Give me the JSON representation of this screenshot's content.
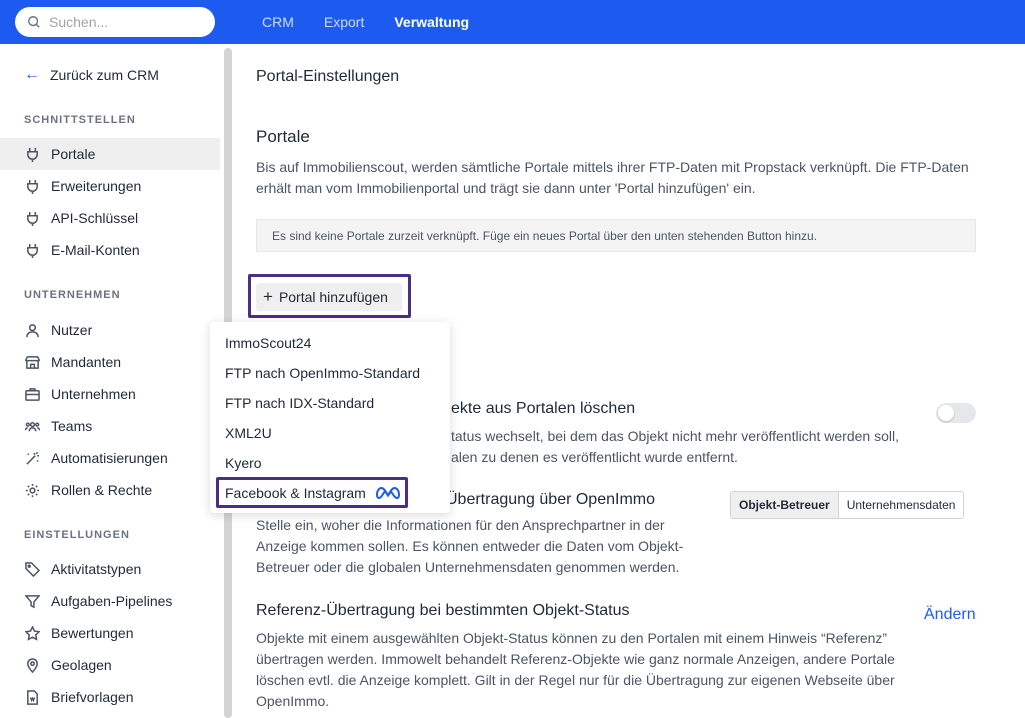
{
  "search": {
    "placeholder": "Suchen..."
  },
  "topnav": [
    "CRM",
    "Export",
    "Verwaltung"
  ],
  "sidebar": {
    "back_label": "Zurück zum CRM",
    "sections": {
      "schnittstellen": "SCHNITTSTELLEN",
      "unternehmen": "UNTERNEHMEN",
      "einstellungen": "EINSTELLUNGEN"
    },
    "items": {
      "portale": "Portale",
      "erweiterungen": "Erweiterungen",
      "api": "API-Schlüssel",
      "email": "E-Mail-Konten",
      "nutzer": "Nutzer",
      "mandanten": "Mandanten",
      "unternehmen": "Unternehmen",
      "teams": "Teams",
      "automatisierungen": "Automatisierungen",
      "rollen": "Rollen & Rechte",
      "aktivitaetstypen": "Aktivitatstypen",
      "pipelines": "Aufgaben-Pipelines",
      "bewertungen": "Bewertungen",
      "geolagen": "Geolagen",
      "briefvorlagen": "Briefvorlagen"
    }
  },
  "main": {
    "page_title": "Portal-Einstellungen",
    "portale_heading": "Portale",
    "portale_desc": "Bis auf Immobilienscout, werden sämtliche Portale mittels ihrer FTP-Daten mit Propstack verknüpft. Die FTP-Daten erhält man vom Immobilienportal und trägt sie dann unter 'Portal hinzufügen' ein.",
    "empty_info": "Es sind keine Portale zurzeit verknüpft. Füge ein neues Portal über den unten stehenden Button hinzu.",
    "add_button": "Portal hinzufügen",
    "delete_heading": "ekte aus Portalen löschen",
    "delete_line1": "tatus wechselt, bei dem das Objekt nicht mehr veröffentlicht werden soll,",
    "delete_line2": "alen zu denen es veröffentlicht wurde entfernt.",
    "contact_heading": "Übertragung über OpenImmo",
    "contact_desc": "Stelle ein, woher die Informationen für den Ansprechpartner in der Anzeige kommen sollen. Es können entweder die Daten vom Objekt-Betreuer oder die globalen Unternehmensdaten genommen werden.",
    "seg_options": [
      "Objekt-Betreuer",
      "Unternehmensdaten"
    ],
    "ref_heading": "Referenz-Übertragung bei bestimmten Objekt-Status",
    "ref_change": "Ändern",
    "ref_desc": "Objekte mit einem ausgewählten Objekt-Status können zu den Portalen mit einem Hinweis “Referenz” übertragen werden. Immowelt behandelt Referenz-Objekte wie ganz normale Anzeigen, andere Portale löschen evtl. die Anzeige komplett. Gilt in der Regel nur für die Übertragung zur eigenen Webseite über OpenImmo."
  },
  "dropdown": {
    "items": [
      "ImmoScout24",
      "FTP nach OpenImmo-Standard",
      "FTP nach IDX-Standard",
      "XML2U",
      "Kyero",
      "Facebook & Instagram"
    ]
  },
  "colors": {
    "brand": "#1d5bf0",
    "highlight": "#4a2f8a"
  }
}
